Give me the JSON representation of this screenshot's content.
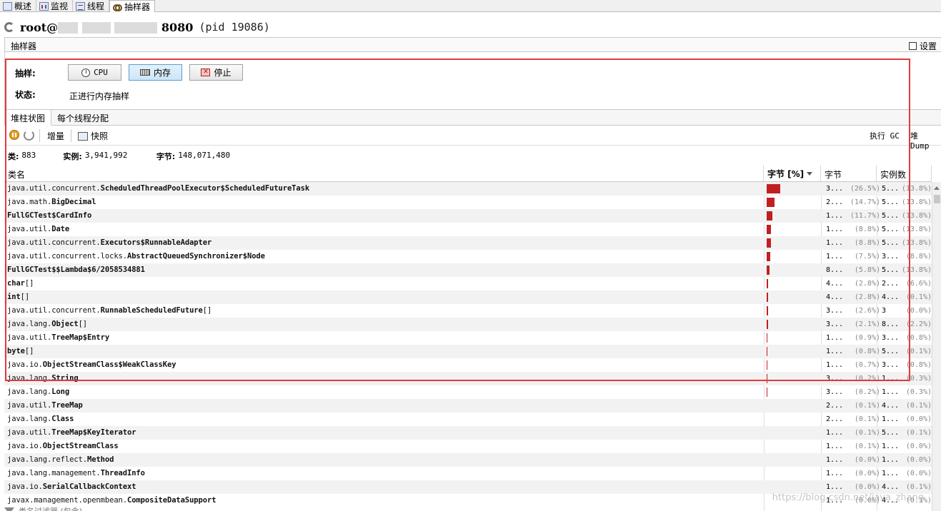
{
  "top_tabs": [
    {
      "label": "概述",
      "icon": "overview-icon"
    },
    {
      "label": "监视",
      "icon": "monitor-icon"
    },
    {
      "label": "线程",
      "icon": "threads-icon"
    },
    {
      "label": "抽样器",
      "icon": "sampler-icon",
      "active": true
    }
  ],
  "title": {
    "host": "root@",
    "port": "8080",
    "pid": "(pid 19086)"
  },
  "sampler": {
    "header": "抽样器",
    "settings_label": "设置",
    "sample_label": "抽样:",
    "buttons": {
      "cpu": "CPU",
      "memory": "内存",
      "stop": "停止"
    },
    "status_label": "状态:",
    "status_text": "正进行内存抽样"
  },
  "sub_tabs": [
    "堆柱状图",
    "每个线程分配"
  ],
  "toolbar": {
    "delta": "增量",
    "snapshot": "快照",
    "gc": "执行 GC",
    "heap_dump": "堆 Dump"
  },
  "summary": {
    "classes_label": "类:",
    "classes": "883",
    "instances_label": "实例:",
    "instances": "3,941,992",
    "bytes_label": "字节:",
    "bytes": "148,071,480"
  },
  "columns": {
    "name": "类名",
    "bytes_pct": "字节 [%]",
    "bytes": "字节",
    "instances": "实例数"
  },
  "rows": [
    {
      "pkg": "java.util.concurrent.",
      "cls": "ScheduledThreadPoolExecutor$ScheduledFutureTask",
      "pct": 26.5,
      "bytes": "3...",
      "bytes_pct": "(26.5%)",
      "inst": "5...",
      "inst_pct": "(13.8%)"
    },
    {
      "pkg": "java.math.",
      "cls": "BigDecimal",
      "pct": 14.7,
      "bytes": "2...",
      "bytes_pct": "(14.7%)",
      "inst": "5...",
      "inst_pct": "(13.8%)"
    },
    {
      "pkg": "",
      "cls": "FullGCTest$CardInfo",
      "pct": 11.7,
      "bytes": "1...",
      "bytes_pct": "(11.7%)",
      "inst": "5...",
      "inst_pct": "(13.8%)"
    },
    {
      "pkg": "java.util.",
      "cls": "Date",
      "pct": 8.8,
      "bytes": "1...",
      "bytes_pct": "(8.8%)",
      "inst": "5...",
      "inst_pct": "(13.8%)"
    },
    {
      "pkg": "java.util.concurrent.",
      "cls": "Executors$RunnableAdapter",
      "pct": 8.8,
      "bytes": "1...",
      "bytes_pct": "(8.8%)",
      "inst": "5...",
      "inst_pct": "(13.8%)"
    },
    {
      "pkg": "java.util.concurrent.locks.",
      "cls": "AbstractQueuedSynchronizer$Node",
      "pct": 7.5,
      "bytes": "1...",
      "bytes_pct": "(7.5%)",
      "inst": "3...",
      "inst_pct": "(8.8%)"
    },
    {
      "pkg": "",
      "cls": "FullGCTest$$Lambda$6/2058534881",
      "pct": 5.8,
      "bytes": "8...",
      "bytes_pct": "(5.8%)",
      "inst": "5...",
      "inst_pct": "(13.8%)"
    },
    {
      "pkg": "",
      "cls": "char",
      "suffix": "[]",
      "pct": 2.8,
      "bytes": "4...",
      "bytes_pct": "(2.8%)",
      "inst": "2...",
      "inst_pct": "(6.6%)"
    },
    {
      "pkg": "",
      "cls": "int",
      "suffix": "[]",
      "pct": 2.8,
      "bytes": "4...",
      "bytes_pct": "(2.8%)",
      "inst": "4...",
      "inst_pct": "(0.1%)"
    },
    {
      "pkg": "java.util.concurrent.",
      "cls": "RunnableScheduledFuture",
      "suffix": "[]",
      "pct": 2.6,
      "bytes": "3...",
      "bytes_pct": "(2.6%)",
      "inst": "3",
      "inst_pct": "(0.0%)"
    },
    {
      "pkg": "java.lang.",
      "cls": "Object",
      "suffix": "[]",
      "pct": 2.1,
      "bytes": "3...",
      "bytes_pct": "(2.1%)",
      "inst": "8...",
      "inst_pct": "(2.2%)"
    },
    {
      "pkg": "java.util.",
      "cls": "TreeMap$Entry",
      "pct": 0.9,
      "bytes": "1...",
      "bytes_pct": "(0.9%)",
      "inst": "3...",
      "inst_pct": "(0.8%)"
    },
    {
      "pkg": "",
      "cls": "byte",
      "suffix": "[]",
      "pct": 0.8,
      "bytes": "1...",
      "bytes_pct": "(0.8%)",
      "inst": "5...",
      "inst_pct": "(0.1%)"
    },
    {
      "pkg": "java.io.",
      "cls": "ObjectStreamClass$WeakClassKey",
      "pct": 0.7,
      "bytes": "1...",
      "bytes_pct": "(0.7%)",
      "inst": "3...",
      "inst_pct": "(0.8%)"
    },
    {
      "pkg": "java.lang.",
      "cls": "String",
      "pct": 0.2,
      "bytes": "3...",
      "bytes_pct": "(0.2%)",
      "inst": "1...",
      "inst_pct": "(0.3%)"
    },
    {
      "pkg": "java.lang.",
      "cls": "Long",
      "pct": 0.2,
      "bytes": "3...",
      "bytes_pct": "(0.2%)",
      "inst": "1...",
      "inst_pct": "(0.3%)"
    },
    {
      "pkg": "java.util.",
      "cls": "TreeMap",
      "pct": 0.1,
      "bytes": "2...",
      "bytes_pct": "(0.1%)",
      "inst": "4...",
      "inst_pct": "(0.1%)"
    },
    {
      "pkg": "java.lang.",
      "cls": "Class",
      "pct": 0.1,
      "bytes": "2...",
      "bytes_pct": "(0.1%)",
      "inst": "1...",
      "inst_pct": "(0.0%)"
    },
    {
      "pkg": "java.util.",
      "cls": "TreeMap$KeyIterator",
      "pct": 0.1,
      "bytes": "1...",
      "bytes_pct": "(0.1%)",
      "inst": "5...",
      "inst_pct": "(0.1%)"
    },
    {
      "pkg": "java.io.",
      "cls": "ObjectStreamClass",
      "pct": 0.1,
      "bytes": "1...",
      "bytes_pct": "(0.1%)",
      "inst": "1...",
      "inst_pct": "(0.0%)"
    },
    {
      "pkg": "java.lang.reflect.",
      "cls": "Method",
      "pct": 0.0,
      "bytes": "1...",
      "bytes_pct": "(0.0%)",
      "inst": "1...",
      "inst_pct": "(0.0%)"
    },
    {
      "pkg": "java.lang.management.",
      "cls": "ThreadInfo",
      "pct": 0.0,
      "bytes": "1...",
      "bytes_pct": "(0.0%)",
      "inst": "1...",
      "inst_pct": "(0.0%)"
    },
    {
      "pkg": "java.io.",
      "cls": "SerialCallbackContext",
      "pct": 0.0,
      "bytes": "1...",
      "bytes_pct": "(0.0%)",
      "inst": "4...",
      "inst_pct": "(0.1%)"
    },
    {
      "pkg": "javax.management.openmbean.",
      "cls": "CompositeDataSupport",
      "pct": 0.0,
      "bytes": "1...",
      "bytes_pct": "(0.0%)",
      "inst": "4...",
      "inst_pct": "(0.1%)"
    }
  ],
  "filter_placeholder": "类名过滤器 (包含)",
  "watermark": "https://blog.csdn.net/java_zhang",
  "colors": {
    "bar": "#c02020",
    "highlight_box": "#e23a3a"
  }
}
